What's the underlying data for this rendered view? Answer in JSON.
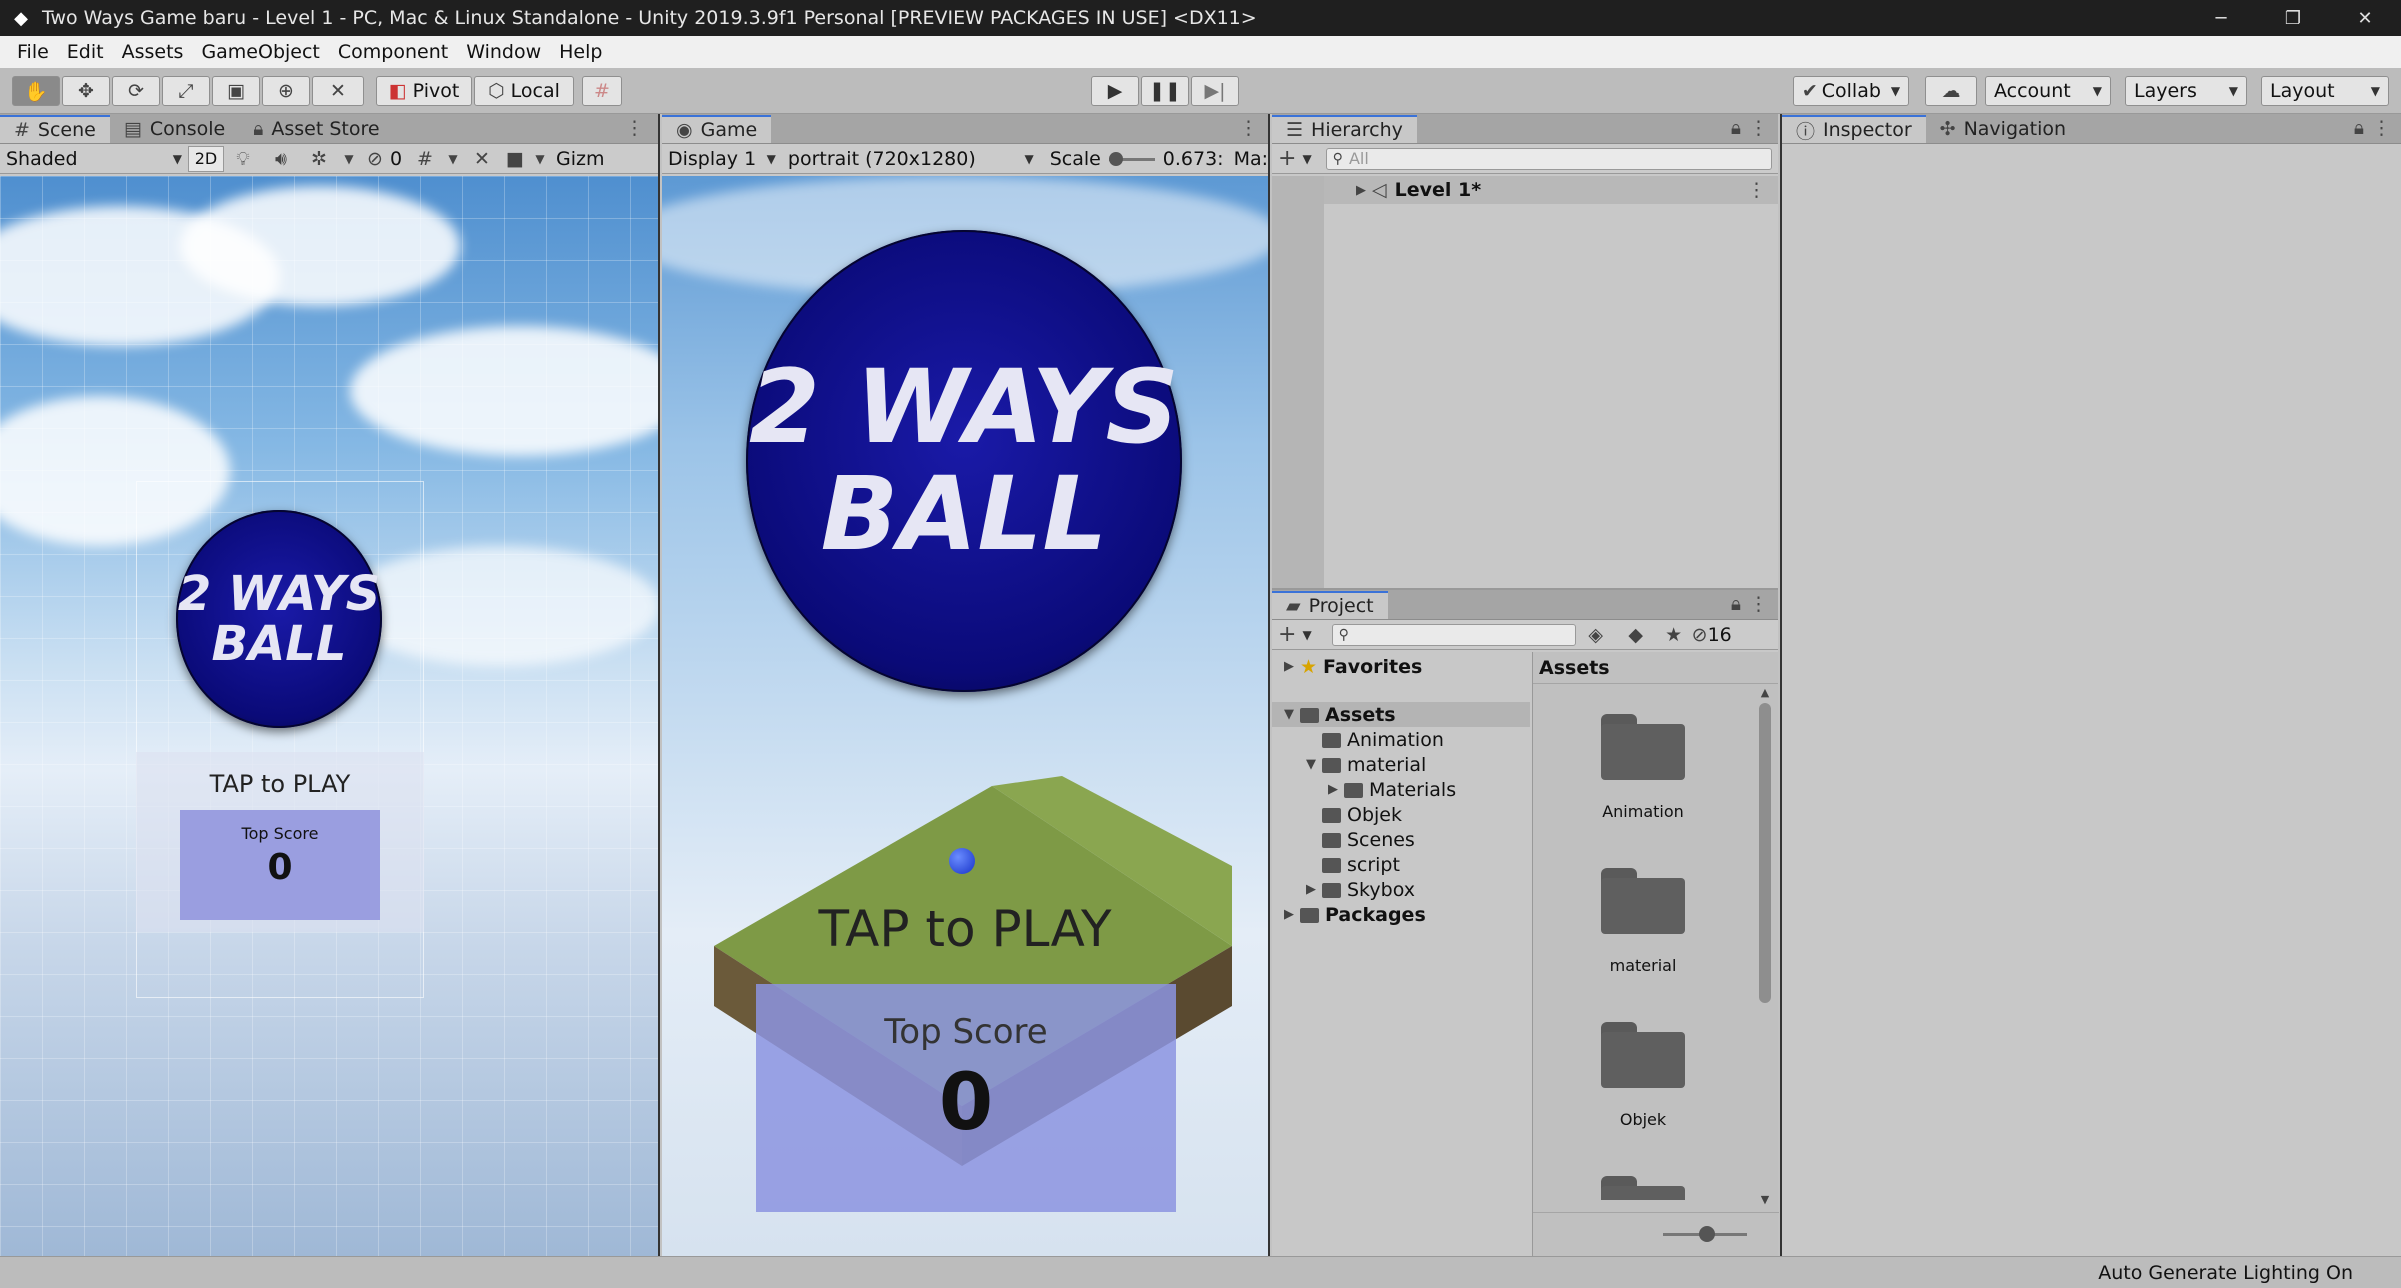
{
  "window": {
    "title": "Two Ways Game baru - Level 1 - PC, Mac & Linux Standalone - Unity 2019.3.9f1 Personal [PREVIEW PACKAGES IN USE] <DX11>",
    "controls": [
      "─",
      "❐",
      "✕"
    ]
  },
  "menu": [
    "File",
    "Edit",
    "Assets",
    "GameObject",
    "Component",
    "Window",
    "Help"
  ],
  "toolbar": {
    "pivot": "Pivot",
    "local": "Local",
    "collab": "Collab",
    "account": "Account",
    "layers": "Layers",
    "layout": "Layout"
  },
  "scene_panel": {
    "tabs": [
      "Scene",
      "Console",
      "Asset Store"
    ],
    "shading": "Shaded",
    "mode_2d": "2D",
    "hidden_count": "0",
    "gizmos": "Gizm",
    "logo_line1": "2 WAYS",
    "logo_line2": "BALL",
    "tap_text": "TAP to PLAY",
    "top_score_label": "Top Score",
    "top_score_value": "0"
  },
  "game_panel": {
    "tab": "Game",
    "display": "Display 1",
    "resolution": "portrait (720x1280)",
    "scale_label": "Scale",
    "scale_value": "0.673:",
    "maximize": "Ma:",
    "logo_line1": "2 WAYS",
    "logo_line2": "BALL",
    "tap_text": "TAP to PLAY",
    "top_score_label": "Top Score",
    "top_score_value": "0"
  },
  "hierarchy": {
    "tab": "Hierarchy",
    "search_placeholder": "All",
    "root": "Level 1*"
  },
  "project": {
    "tab": "Project",
    "hidden_count": "16",
    "favorites": "Favorites",
    "assets_root": "Assets",
    "tree": [
      {
        "label": "Animation",
        "indent": 1,
        "arrow": ""
      },
      {
        "label": "material",
        "indent": 1,
        "arrow": "▼"
      },
      {
        "label": "Materials",
        "indent": 2,
        "arrow": "▶"
      },
      {
        "label": "Objek",
        "indent": 1,
        "arrow": ""
      },
      {
        "label": "Scenes",
        "indent": 1,
        "arrow": ""
      },
      {
        "label": "script",
        "indent": 1,
        "arrow": ""
      },
      {
        "label": "Skybox",
        "indent": 1,
        "arrow": "▶"
      }
    ],
    "packages": "Packages",
    "grid_title": "Assets",
    "grid_items": [
      "Animation",
      "material",
      "Objek"
    ]
  },
  "inspector": {
    "tabs": [
      "Inspector",
      "Navigation"
    ]
  },
  "status": {
    "text": "Auto Generate Lighting On"
  },
  "colors": {
    "accent": "#3a72d8",
    "logo_blue": "#0a0a78",
    "score_box": "#9a9ee0"
  }
}
